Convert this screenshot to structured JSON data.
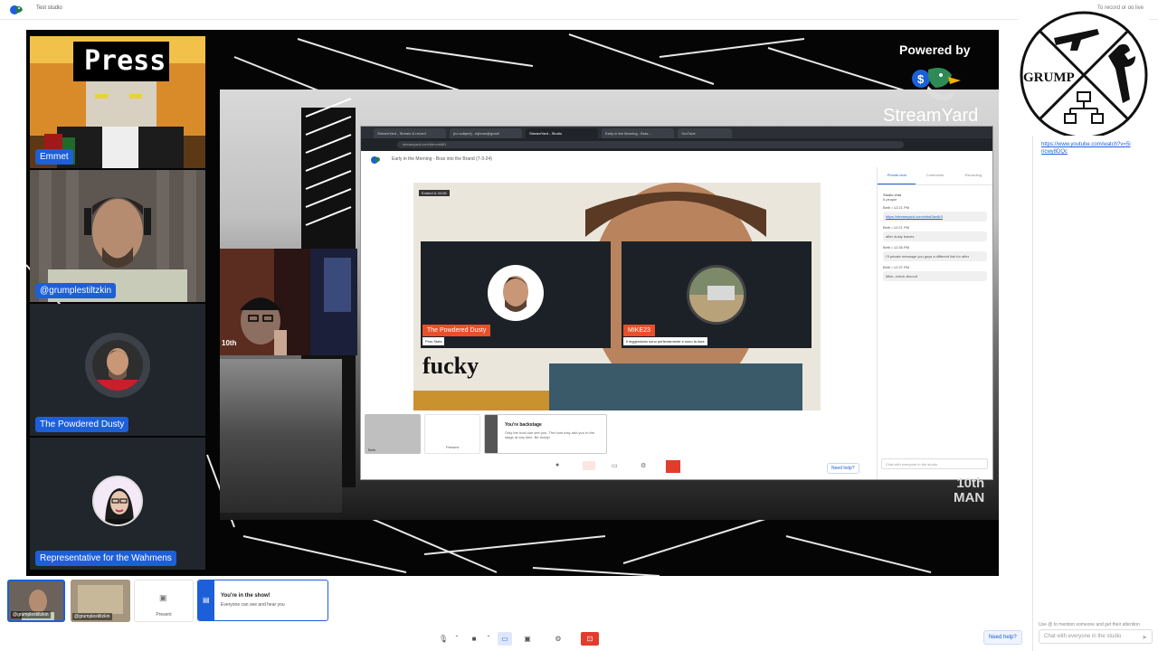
{
  "app": {
    "title": "Test studio",
    "top_right": "To record or go live",
    "accent": "#1d5fd8",
    "leave_color": "#e33b2e"
  },
  "stage": {
    "participants": [
      {
        "name": "Emmet"
      },
      {
        "name": "@grumplestiltzkin"
      },
      {
        "name": "The Powdered Dusty"
      },
      {
        "name": "Representative for the Wahmens"
      }
    ],
    "press_text": "Press",
    "powered_by": "Powered by",
    "brand": "StreamYard",
    "overlay_tenth": "10th",
    "overlay_tenth_man": "10th\nMAN"
  },
  "screenshare": {
    "tabs": [
      "StreamYard - Stream & record",
      "[no subject] - mjbrow@gmail",
      "StreamYard - Studio",
      "Early in the Morning - Bras...",
      "YouTube"
    ],
    "url": "streamyard.com/bbrxmk8f1",
    "studio_title": "Early in the Morning - Bras into the Brand (7-3-24)",
    "badge": "Embed & 04:06",
    "cards": [
      {
        "name": "The Powdered Dusty",
        "sub": "Pros Stats"
      },
      {
        "name": "MIKE23",
        "sub": "Il leggendario sono perfectamente e sono la luna"
      }
    ],
    "caption": "fucky",
    "chat_tabs": [
      "Private chat",
      "Comments",
      "Recording"
    ],
    "chat_title": "Studio chat",
    "chat_sub": "5 people",
    "messages": [
      {
        "who": "Beth • 12:21 PM",
        "text": "https://streamyard.com/wfwk3ax6r3",
        "link": true
      },
      {
        "who": "Beth • 12:21 PM",
        "text": "after dusty leaves",
        "link": false
      },
      {
        "who": "Beth • 12:36 PM",
        "text": "I'll private message you guys a different link for after",
        "link": false
      },
      {
        "who": "Beth • 12:37 PM",
        "text": "Mike, check discord",
        "link": false
      }
    ],
    "backstage_title": "You're backstage",
    "backstage_text": "Only the host can see you. The host may add you to the stage at any time. Be ready!",
    "backstage_present": "Present",
    "backstage_thumb": "Beth",
    "need_help": "Need help?",
    "chat_placeholder": "Chat with everyone in the studio"
  },
  "sidebar": {
    "link": "https://www.youtube.com/watch?v=5incwy8DQc",
    "hint": "Use @ to mention someone and get their attention",
    "placeholder": "Chat with everyone in the studio"
  },
  "tray": {
    "thumbs": [
      {
        "label": "@grumplestiltzkin"
      },
      {
        "label": "@grumplestiltzkin"
      }
    ],
    "present_label": "Present",
    "in_show_title": "You're in the show!",
    "in_show_text": "Everyone can see and hear you"
  },
  "controls": {
    "need_help": "Need help?"
  }
}
